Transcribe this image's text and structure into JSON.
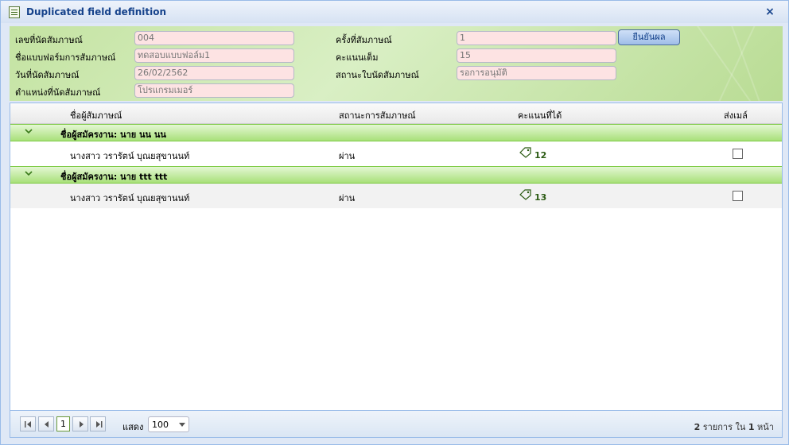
{
  "window": {
    "title": "Duplicated field definition",
    "close_label": "×"
  },
  "form": {
    "left": [
      {
        "label": "เลขที่นัดสัมภาษณ์",
        "value": "004"
      },
      {
        "label": "ชื่อแบบฟอร์มการสัมภาษณ์",
        "value": "ทดสอบแบบฟอล์ม1"
      },
      {
        "label": "วันที่นัดสัมภาษณ์",
        "value": "26/02/2562"
      },
      {
        "label": "ตำแหน่งที่นัดสัมภาษณ์",
        "value": "โปรแกรมเมอร์"
      }
    ],
    "right": [
      {
        "label": "ครั้งที่สัมภาษณ์",
        "value": "1"
      },
      {
        "label": "คะแนนเต็ม",
        "value": "15"
      },
      {
        "label": "สถานะใบนัดสัมภาษณ์",
        "value": "รอการอนุมัติ"
      }
    ],
    "confirm_button": "ยืนยันผล"
  },
  "grid": {
    "columns": [
      "ชื่อผู้สัมภาษณ์",
      "สถานะการสัมภาษณ์",
      "คะแนนที่ได้",
      "ส่งเมล์"
    ],
    "groups": [
      {
        "label": "ชื่อผู้สมัครงาน: นาย นน นน",
        "rows": [
          {
            "interviewer": "นางสาว วรารัตน์ บุณยสุขานนท์",
            "status": "ผ่าน",
            "score": "12",
            "send_mail": false
          }
        ]
      },
      {
        "label": "ชื่อผู้สมัครงาน: นาย ttt ttt",
        "rows": [
          {
            "interviewer": "นางสาว วรารัตน์ บุณยสุขานนท์",
            "status": "ผ่าน",
            "score": "13",
            "send_mail": false
          }
        ]
      }
    ]
  },
  "pager": {
    "current_page": "1",
    "show_label": "แสดง",
    "page_size": "100",
    "summary_count": "2",
    "summary_mid": "รายการ ใน",
    "summary_pages": "1",
    "summary_end": "หน้า"
  },
  "icons": {
    "title": "form-icon",
    "expand": "chevron-down-icon",
    "score": "tag-icon",
    "first": "first-page-icon",
    "prev": "prev-page-icon",
    "next": "next-page-icon",
    "last": "last-page-icon"
  }
}
